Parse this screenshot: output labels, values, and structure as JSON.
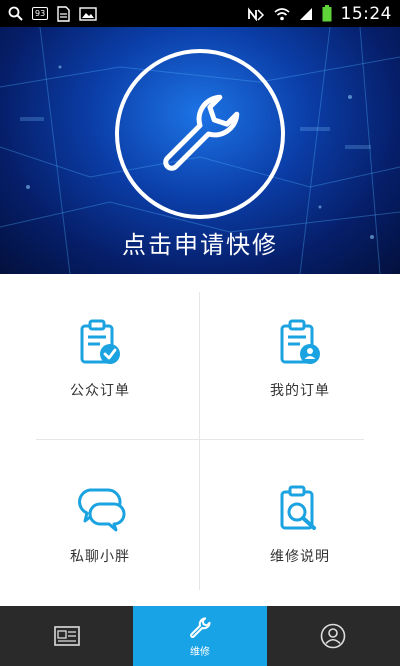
{
  "status_bar": {
    "time": "15:24",
    "left_icons": [
      "search-icon",
      "battery-saver-icon",
      "file-icon",
      "image-icon"
    ],
    "right_icons": [
      "no-sim-icon",
      "wifi-icon",
      "signal-icon",
      "battery-icon"
    ],
    "badge_text": "93"
  },
  "banner": {
    "title": "点击申请快修",
    "icon": "wrench-icon"
  },
  "grid": {
    "items": [
      {
        "label": "公众订单",
        "icon": "clipboard-check-icon"
      },
      {
        "label": "我的订单",
        "icon": "clipboard-user-icon"
      },
      {
        "label": "私聊小胖",
        "icon": "chat-bubbles-icon"
      },
      {
        "label": "维修说明",
        "icon": "clipboard-search-icon"
      }
    ]
  },
  "bottom_nav": {
    "items": [
      {
        "label": "",
        "icon": "news-icon"
      },
      {
        "label": "维修",
        "icon": "wrench-icon",
        "active": true
      },
      {
        "label": "",
        "icon": "user-icon"
      }
    ]
  },
  "colors": {
    "accent": "#18a3e6",
    "icon_blue": "#1aa3e0",
    "nav_background": "#2a2a2a",
    "banner_dark": "#061f6b"
  }
}
